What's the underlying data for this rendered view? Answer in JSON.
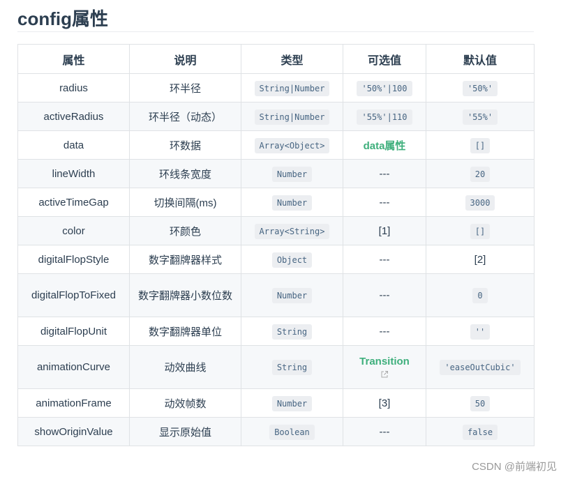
{
  "page": {
    "title": "config属性"
  },
  "table": {
    "headers": [
      "属性",
      "说明",
      "类型",
      "可选值",
      "默认值"
    ],
    "rows": [
      {
        "prop": "radius",
        "desc": "环半径",
        "type": "String|Number",
        "options": "'50%'|100",
        "default": "'50%'"
      },
      {
        "prop": "activeRadius",
        "desc": "环半径（动态）",
        "type": "String|Number",
        "options": "'55%'|110",
        "default": "'55%'"
      },
      {
        "prop": "data",
        "desc": "环数据",
        "type": "Array<Object>",
        "options": "data属性",
        "default": "[]"
      },
      {
        "prop": "lineWidth",
        "desc": "环线条宽度",
        "type": "Number",
        "options": "---",
        "default": "20"
      },
      {
        "prop": "activeTimeGap",
        "desc": "切换间隔(ms)",
        "type": "Number",
        "options": "---",
        "default": "3000"
      },
      {
        "prop": "color",
        "desc": "环颜色",
        "type": "Array<String>",
        "options": "[1]",
        "default": "[]"
      },
      {
        "prop": "digitalFlopStyle",
        "desc": "数字翻牌器样式",
        "type": "Object",
        "options": "---",
        "default": "[2]"
      },
      {
        "prop": "digitalFlopToFixed",
        "desc": "数字翻牌器小数位数",
        "type": "Number",
        "options": "---",
        "default": "0"
      },
      {
        "prop": "digitalFlopUnit",
        "desc": "数字翻牌器单位",
        "type": "String",
        "options": "---",
        "default": "''"
      },
      {
        "prop": "animationCurve",
        "desc": "动效曲线",
        "type": "String",
        "options": "Transition",
        "default": "'easeOutCubic'"
      },
      {
        "prop": "animationFrame",
        "desc": "动效帧数",
        "type": "Number",
        "options": "[3]",
        "default": "50"
      },
      {
        "prop": "showOriginValue",
        "desc": "显示原始值",
        "type": "Boolean",
        "options": "---",
        "default": "false"
      }
    ]
  },
  "watermark": "CSDN @前端初见",
  "colors": {
    "link": "#3eaf7c",
    "code_text": "#476582",
    "code_bg": "#eceef1",
    "zebra": "#f6f8fa",
    "border": "#dfe2e5"
  },
  "icons": {
    "external_link": "external-link-icon"
  }
}
